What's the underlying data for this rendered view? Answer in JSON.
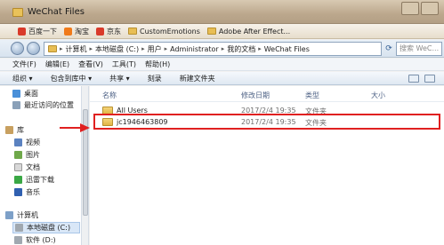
{
  "window": {
    "title": "WeChat Files"
  },
  "favorites": [
    {
      "label": "百度一下",
      "icon": "baidu-icon"
    },
    {
      "label": "淘宝",
      "icon": "taobao-icon"
    },
    {
      "label": "京东",
      "icon": "jd-icon"
    },
    {
      "label": "CustomEmotions",
      "icon": "folder-icon"
    },
    {
      "label": "Adobe After Effect...",
      "icon": "folder-icon"
    }
  ],
  "address": {
    "crumbs": [
      "计算机",
      "本地磁盘 (C:)",
      "用户",
      "Administrator",
      "我的文档",
      "WeChat Files"
    ],
    "search_placeholder": "搜索 WeC..."
  },
  "menu": [
    "文件(F)",
    "编辑(E)",
    "查看(V)",
    "工具(T)",
    "帮助(H)"
  ],
  "commands": [
    "组织 ▾",
    "包含到库中 ▾",
    "共享 ▾",
    "刻录",
    "新建文件夹"
  ],
  "sidebar": {
    "favorites_items": [
      {
        "label": "桌面",
        "icon": "desktop-icon"
      },
      {
        "label": "最近访问的位置",
        "icon": "recent-places-icon"
      }
    ],
    "library_label": "库",
    "library_items": [
      {
        "label": "视频",
        "icon": "video-icon"
      },
      {
        "label": "图片",
        "icon": "picture-icon"
      },
      {
        "label": "文档",
        "icon": "document-icon"
      },
      {
        "label": "迅雷下载",
        "icon": "download-icon"
      },
      {
        "label": "音乐",
        "icon": "music-icon"
      }
    ],
    "computer_label": "计算机",
    "drives": [
      {
        "label": "本地磁盘 (C:)",
        "selected": true
      },
      {
        "label": "软件 (D:)",
        "selected": false
      }
    ]
  },
  "columns": {
    "name": "名称",
    "date": "修改日期",
    "type": "类型",
    "size": "大小"
  },
  "files": [
    {
      "name": "All Users",
      "date": "2017/2/4 19:35",
      "type": "文件夹"
    },
    {
      "name": "jc1946463809",
      "date": "2017/2/4 19:35",
      "type": "文件夹"
    }
  ],
  "colors": {
    "highlight": "#e02020",
    "folder": "#e8be54"
  }
}
